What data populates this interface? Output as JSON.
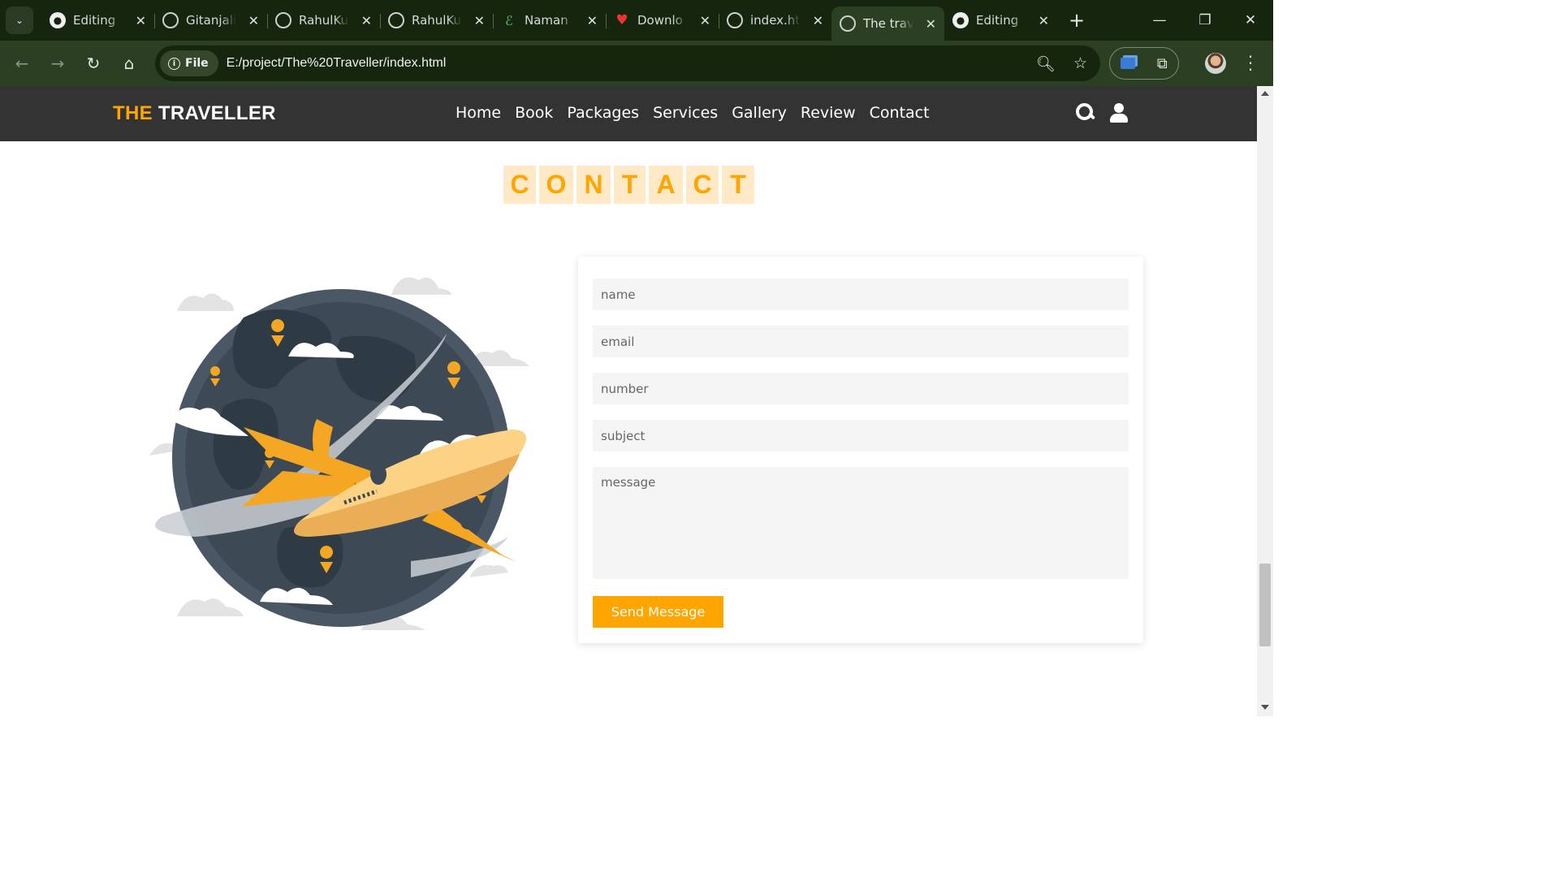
{
  "browser": {
    "tabs": [
      {
        "title": "Editing",
        "icon": "github-icon"
      },
      {
        "title": "Gitanjali",
        "icon": "globe-icon"
      },
      {
        "title": "RahulKu",
        "icon": "globe-icon"
      },
      {
        "title": "RahulKu",
        "icon": "globe-icon"
      },
      {
        "title": "Naman",
        "icon": "leaf-icon"
      },
      {
        "title": "Downlo",
        "icon": "heart-icon"
      },
      {
        "title": "index.ht",
        "icon": "globe-icon"
      },
      {
        "title": "The trav",
        "icon": "globe-icon",
        "active": true
      },
      {
        "title": "Editing",
        "icon": "github-icon"
      }
    ],
    "chip_label": "File",
    "url": "E:/project/The%20Traveller/index.html"
  },
  "site": {
    "logo_accent": "THE",
    "logo_rest": " TRAVELLER",
    "nav": [
      "Home",
      "Book",
      "Packages",
      "Services",
      "Gallery",
      "Review",
      "Contact"
    ],
    "heading_letters": [
      "C",
      "O",
      "N",
      "T",
      "A",
      "C",
      "T"
    ]
  },
  "form": {
    "name_placeholder": "name",
    "email_placeholder": "email",
    "number_placeholder": "number",
    "subject_placeholder": "subject",
    "message_placeholder": "message",
    "submit_label": "Send Message"
  },
  "colors": {
    "accent": "#ffa500",
    "header_bg": "#333333",
    "chrome_dark": "#16260e",
    "chrome_toolbar": "#2b4022"
  }
}
